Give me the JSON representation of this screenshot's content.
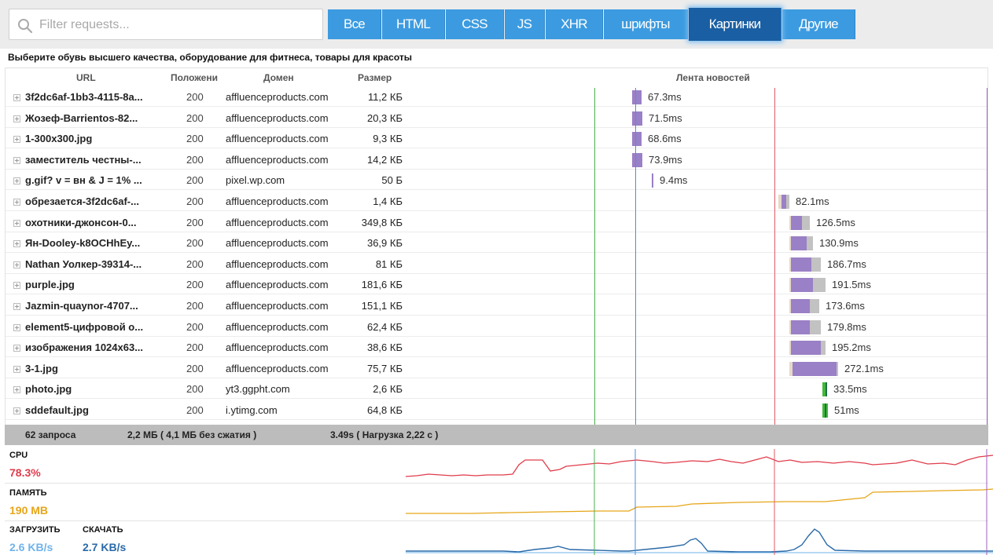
{
  "toolbar": {
    "filter_placeholder": "Filter requests...",
    "tabs": [
      "Все",
      "HTML",
      "CSS",
      "JS",
      "XHR",
      "шрифты",
      "Картинки",
      "Другие"
    ],
    "active_tab": "Картинки",
    "accent_color": "#3c9be0",
    "active_color": "#1a5fa3"
  },
  "page_title": "Выберите обувь высшего качества, оборудование для фитнеса, товары для красоты",
  "table": {
    "headers": {
      "url": "URL",
      "status": "Положени",
      "domain": "Домен",
      "size": "Размер",
      "timeline": "Лента новостей"
    },
    "rows": [
      {
        "url": "3f2dc6af-1bb3-4115-8a...",
        "status": "200",
        "domain": "affluenceproducts.com",
        "size": "11,2 КБ",
        "time": "67.3ms"
      },
      {
        "url": "Жозеф-Barrientos-82...",
        "status": "200",
        "domain": "affluenceproducts.com",
        "size": "20,3 КБ",
        "time": "71.5ms"
      },
      {
        "url": "1-300x300.jpg",
        "status": "200",
        "domain": "affluenceproducts.com",
        "size": "9,3 КБ",
        "time": "68.6ms"
      },
      {
        "url": "заместитель честны-...",
        "status": "200",
        "domain": "affluenceproducts.com",
        "size": "14,2 КБ",
        "time": "73.9ms"
      },
      {
        "url": "g.gif? v = вн & J = 1% ...",
        "status": "200",
        "domain": "pixel.wp.com",
        "size": "50 Б",
        "time": "9.4ms"
      },
      {
        "url": "обрезается-3f2dc6af-...",
        "status": "200",
        "domain": "affluenceproducts.com",
        "size": "1,4 КБ",
        "time": "82.1ms"
      },
      {
        "url": "охотники-джонсон-0...",
        "status": "200",
        "domain": "affluenceproducts.com",
        "size": "349,8 КБ",
        "time": "126.5ms"
      },
      {
        "url": "Ян-Dooley-k8OCHhEy...",
        "status": "200",
        "domain": "affluenceproducts.com",
        "size": "36,9 КБ",
        "time": "130.9ms"
      },
      {
        "url": "Nathan Уолкер-39314-...",
        "status": "200",
        "domain": "affluenceproducts.com",
        "size": "81 КБ",
        "time": "186.7ms"
      },
      {
        "url": "purple.jpg",
        "status": "200",
        "domain": "affluenceproducts.com",
        "size": "181,6 КБ",
        "time": "191.5ms"
      },
      {
        "url": "Jazmin-quaynor-4707...",
        "status": "200",
        "domain": "affluenceproducts.com",
        "size": "151,1 КБ",
        "time": "173.6ms"
      },
      {
        "url": "element5-цифровой о...",
        "status": "200",
        "domain": "affluenceproducts.com",
        "size": "62,4 КБ",
        "time": "179.8ms"
      },
      {
        "url": "изображения 1024x63...",
        "status": "200",
        "domain": "affluenceproducts.com",
        "size": "38,6 КБ",
        "time": "195.2ms"
      },
      {
        "url": "3-1.jpg",
        "status": "200",
        "domain": "affluenceproducts.com",
        "size": "75,7 КБ",
        "time": "272.1ms"
      },
      {
        "url": "photo.jpg",
        "status": "200",
        "domain": "yt3.ggpht.com",
        "size": "2,6 КБ",
        "time": "33.5ms"
      },
      {
        "url": "sddefault.jpg",
        "status": "200",
        "domain": "i.ytimg.com",
        "size": "64,8 КБ",
        "time": "51ms"
      }
    ]
  },
  "summary": {
    "requests": "62 запроса",
    "transfer": "2,2 МБ ( 4,1 МБ без сжатия )",
    "timing": "3.49s ( Нагрузка 2,22 с )"
  },
  "metrics": {
    "cpu": {
      "label": "CPU",
      "value": "78.3%",
      "color": "#e03c4b"
    },
    "memory": {
      "label": "ПАМЯТЬ",
      "value": "190 MB",
      "color": "#e6a619"
    },
    "upload": {
      "label": "ЗАГРУЗИТЬ",
      "value": "2.6 KB/s",
      "color": "#6fb3ea"
    },
    "download": {
      "label": "СКАЧАТЬ",
      "value": "2.7 KB/s",
      "color": "#2a6aa8"
    }
  },
  "markers": {
    "dom_color": "#4caf50",
    "start_color": "#4a90e2",
    "load_color": "#e05a66",
    "end_color": "#a05fc0"
  }
}
